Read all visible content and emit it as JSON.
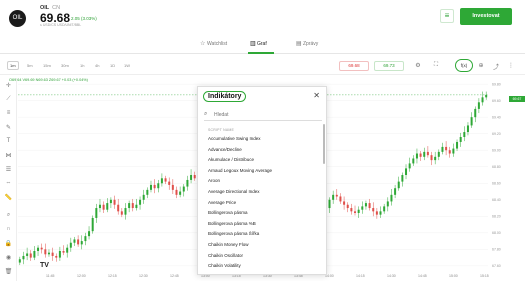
{
  "header": {
    "logo_text": "OIL",
    "symbol": "OIL",
    "country": "CN",
    "price": "69.68",
    "change": "2.05 (3.03%)",
    "subinfo": "≤ USD/CS  USD/UNIT/BBL",
    "menu_icon": "menu-lines-icon",
    "invest_label": "Investovat",
    "accent": "#2ea836"
  },
  "tabs": [
    {
      "label": "Watchlist",
      "icon": "star-icon"
    },
    {
      "label": "Graf",
      "icon": "chart-icon",
      "active": true
    },
    {
      "label": "Zprávy",
      "icon": "news-icon"
    }
  ],
  "toolbar": {
    "timeframes": [
      "1m",
      "5m",
      "15m",
      "30m",
      "1h",
      "4h",
      "1D",
      "1W"
    ],
    "active_timeframe": "1m",
    "sell_value": "69.68",
    "buy_value": "69.73",
    "indicator_label": "f(x)",
    "icons": [
      "settings-icon",
      "fullscreen-icon",
      "indicators-icon",
      "add-icon",
      "share-icon",
      "more-icon"
    ]
  },
  "ohlc": "O69.64 V69.69 N69.63 Z69.67 +0.03 (+0.04%)",
  "left_tools": [
    "crosshair-icon",
    "trendline-icon",
    "horizontal-line-icon",
    "brush-icon",
    "text-icon",
    "pattern-icon",
    "fib-icon",
    "measure-icon",
    "ruler-icon",
    "zoom-icon",
    "magnet-icon",
    "lock-icon",
    "eye-icon",
    "trash-icon"
  ],
  "chart_data": {
    "type": "candlestick",
    "x": [
      "11:45",
      "12:00",
      "12:15",
      "12:30",
      "12:45",
      "13:00",
      "13:15",
      "13:30",
      "13:45",
      "14:00",
      "14:15",
      "14:30",
      "14:45",
      "15:00",
      "15:15"
    ],
    "y_ticks": [
      "69.80",
      "69.60",
      "69.40",
      "69.20",
      "69.00",
      "68.80",
      "68.60",
      "68.40",
      "68.20",
      "68.00",
      "67.80",
      "67.60"
    ],
    "ylim": [
      67.55,
      69.85
    ],
    "last_price": "69.67",
    "colors": {
      "up": "#2ea836",
      "down": "#e0504b"
    },
    "closes": [
      67.68,
      67.72,
      67.75,
      67.7,
      67.78,
      67.82,
      67.8,
      67.74,
      67.76,
      67.72,
      67.7,
      67.78,
      67.76,
      67.82,
      67.88,
      67.92,
      67.86,
      67.9,
      67.96,
      68.02,
      68.18,
      68.3,
      68.34,
      68.28,
      68.36,
      68.4,
      68.34,
      68.26,
      68.22,
      68.3,
      68.36,
      68.3,
      68.34,
      68.4,
      68.46,
      68.52,
      68.58,
      68.54,
      68.6,
      68.66,
      68.62,
      68.58,
      68.52,
      68.46,
      68.5,
      68.56,
      68.64,
      68.7,
      68.66,
      68.62,
      68.56,
      68.5,
      68.44,
      68.48,
      68.42,
      68.38,
      68.3,
      68.34,
      68.28,
      68.22,
      68.16,
      68.2,
      68.12,
      68.08,
      68.04,
      68.0,
      67.96,
      67.9,
      67.84,
      67.8,
      67.76,
      67.72,
      67.68,
      67.66,
      67.7,
      67.74,
      67.72,
      67.76,
      67.8,
      67.86,
      67.92,
      68.0,
      68.1,
      68.22,
      68.3,
      68.4,
      68.46,
      68.44,
      68.38,
      68.34,
      68.3,
      68.26,
      68.24,
      68.28,
      68.32,
      68.36,
      68.3,
      68.26,
      68.22,
      68.26,
      68.32,
      68.38,
      68.46,
      68.54,
      68.62,
      68.7,
      68.78,
      68.84,
      68.9,
      68.96,
      68.92,
      68.98,
      68.94,
      68.88,
      68.92,
      68.98,
      69.04,
      69.0,
      68.96,
      69.02,
      69.1,
      69.16,
      69.22,
      69.3,
      69.4,
      69.5,
      69.58,
      69.64,
      69.67
    ]
  },
  "x_axis_labels": [
    "11:45",
    "12:00",
    "12:15",
    "12:30",
    "12:45",
    "13:00",
    "13:15",
    "13:30",
    "13:45",
    "14:00",
    "14:15",
    "14:30",
    "14:45",
    "15:00",
    "15:15"
  ],
  "watermark": "TV",
  "modal": {
    "title": "Indikátory",
    "search_placeholder": "Hledat",
    "section_label": "SCRIPT NAME",
    "items": [
      "Accumulative Swing Index",
      "Advance/Decline",
      "Akumulace / Distribuce",
      "Arnaud Legoux Moving Average",
      "Aroon",
      "Average Directional Index",
      "Average Price",
      "Bollingerova pásma",
      "Bollingerova pásma %B",
      "Bollingerova pásma Šířka",
      "Chaikin Money Flow",
      "Chaikin Oscillator",
      "Chaikin Volatility"
    ]
  }
}
